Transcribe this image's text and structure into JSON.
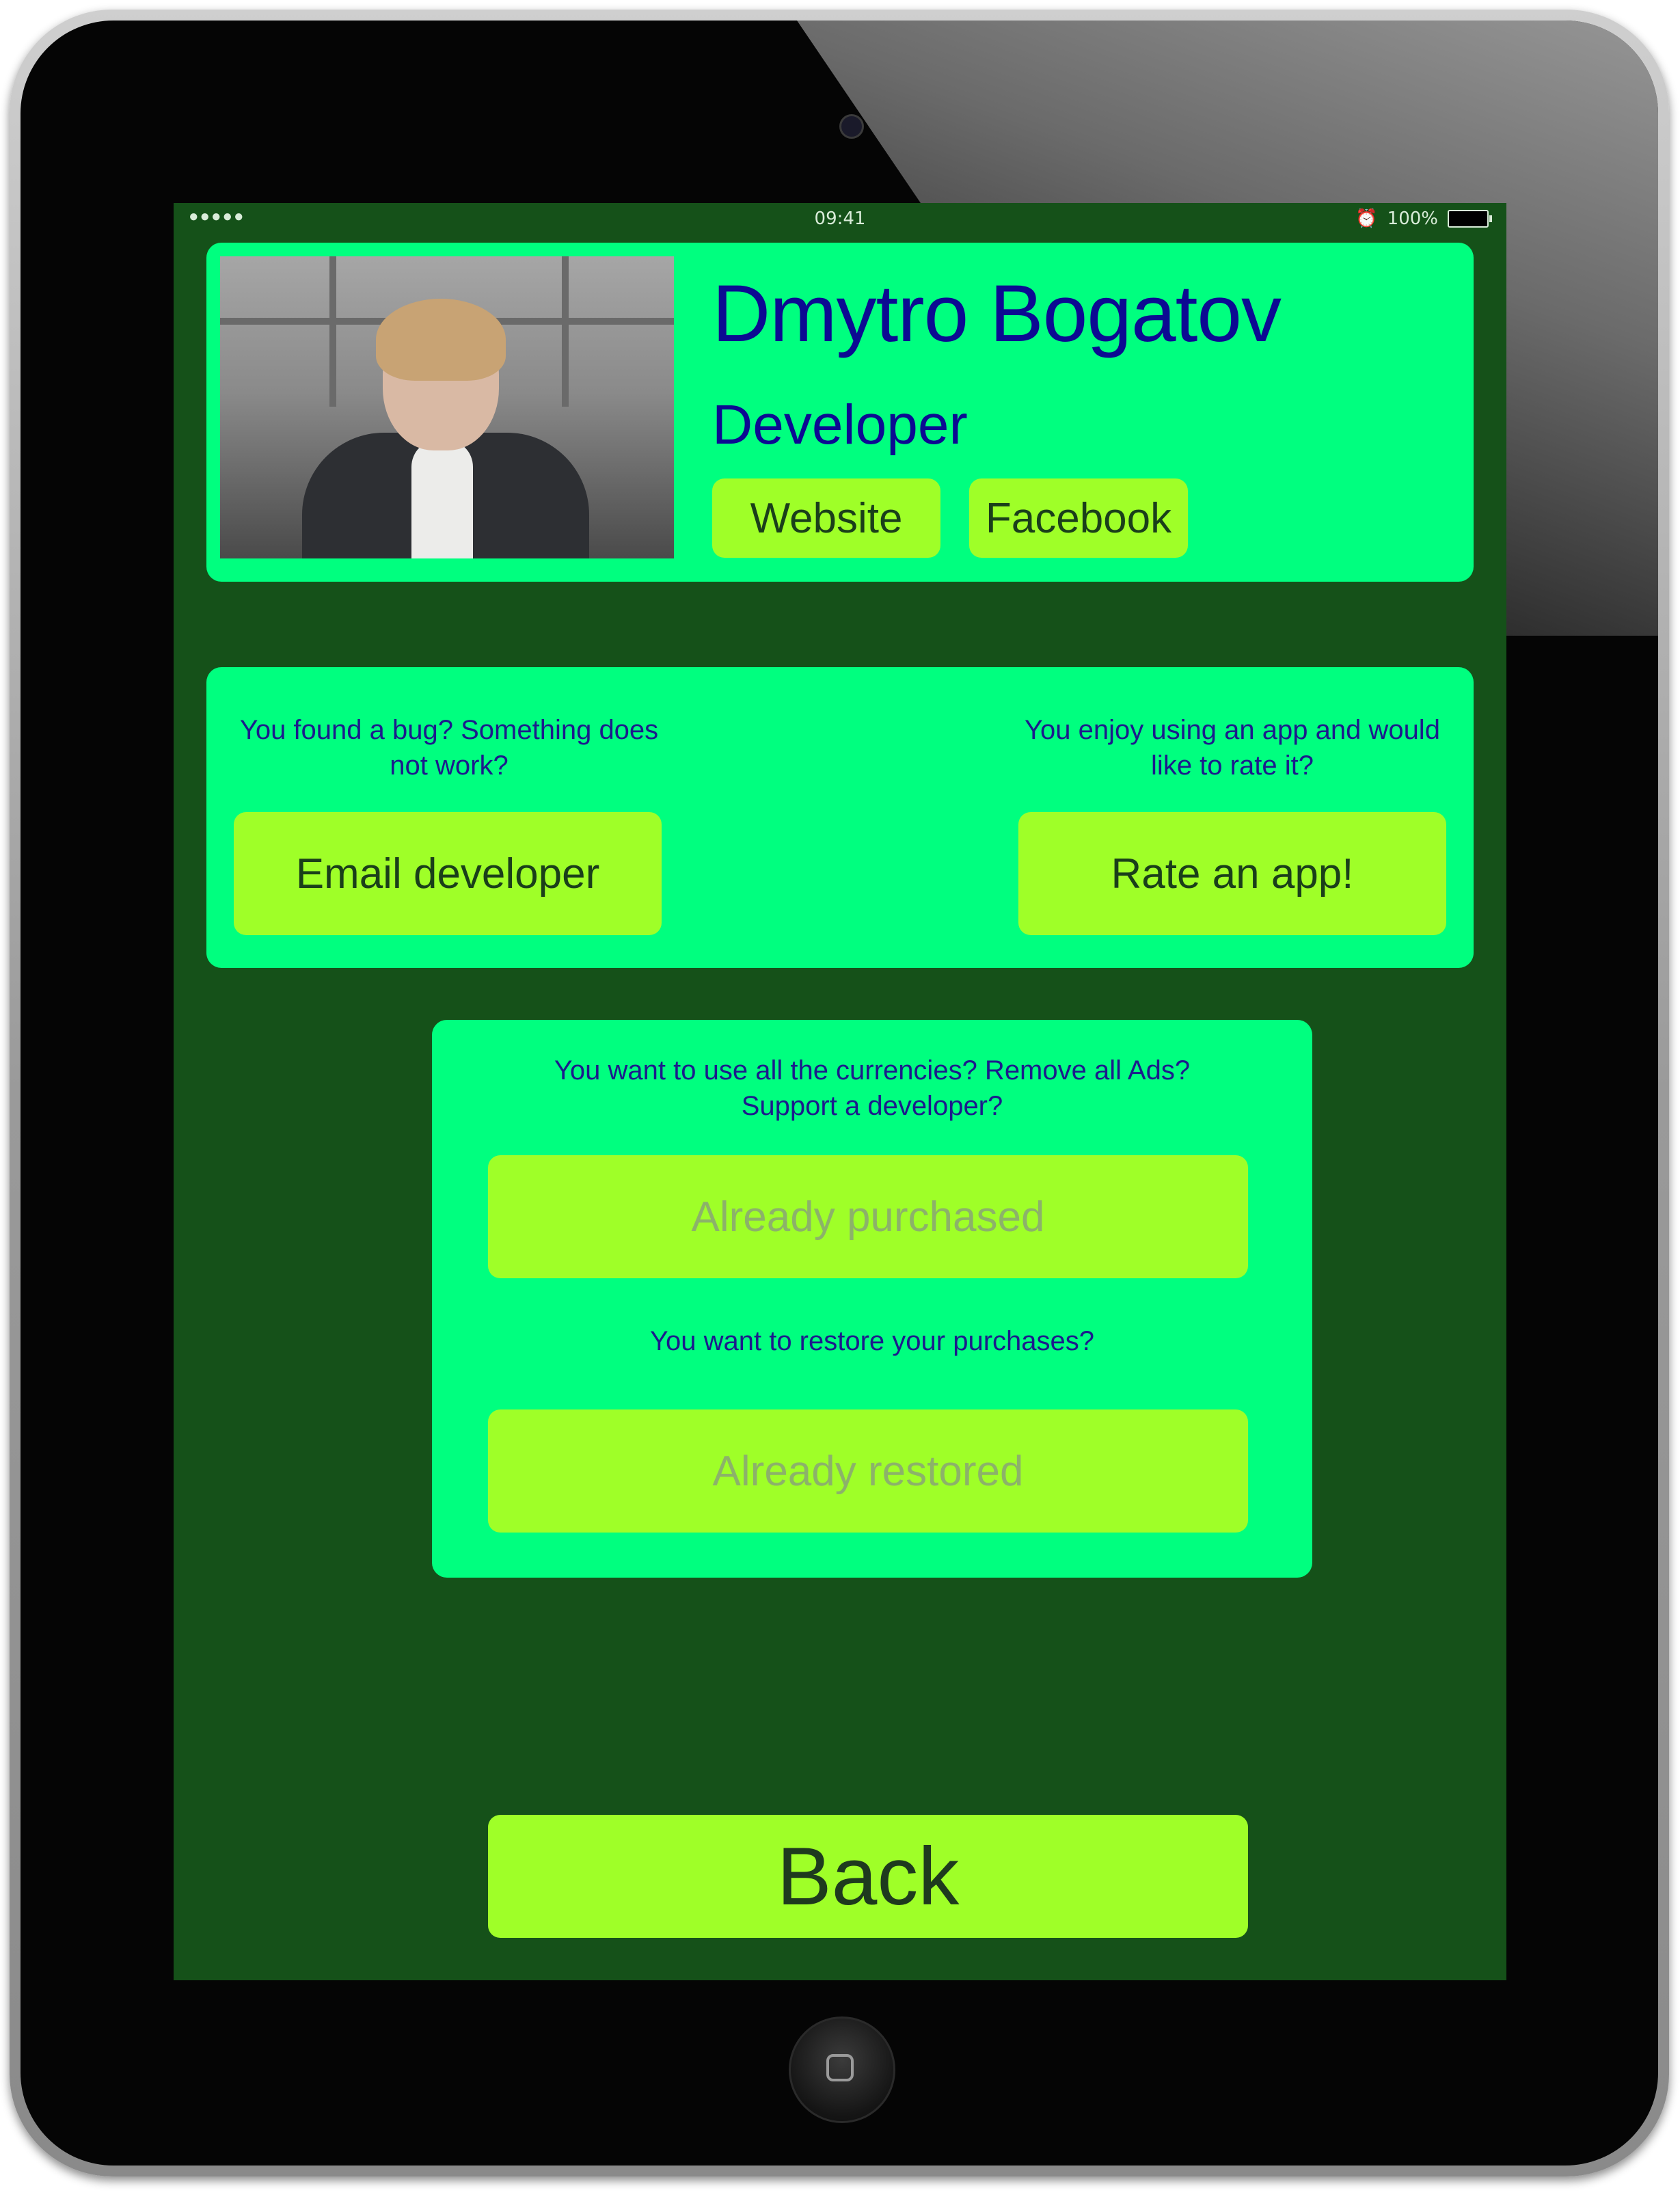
{
  "status_bar": {
    "signal": "●●●●●",
    "time": "09:41",
    "battery": "100%"
  },
  "profile": {
    "name": "Dmytro Bogatov",
    "role": "Developer",
    "website_label": "Website",
    "facebook_label": "Facebook"
  },
  "feedback": {
    "bug_prompt": "You found a bug? Something does not work?",
    "email_label": "Email developer",
    "rate_prompt": "You enjoy using an app and would like to rate it?",
    "rate_label": "Rate an app!"
  },
  "purchases": {
    "purchase_prompt": "You want to use all the currencies? Remove all Ads? Support a developer?",
    "purchase_label": "Already purchased",
    "restore_prompt": "You want to restore your purchases?",
    "restore_label": "Already restored"
  },
  "back_label": "Back",
  "colors": {
    "screen_bg": "#155119",
    "panel": "#00ff7f",
    "button": "#9fff28",
    "title_text": "#0c0a92"
  }
}
